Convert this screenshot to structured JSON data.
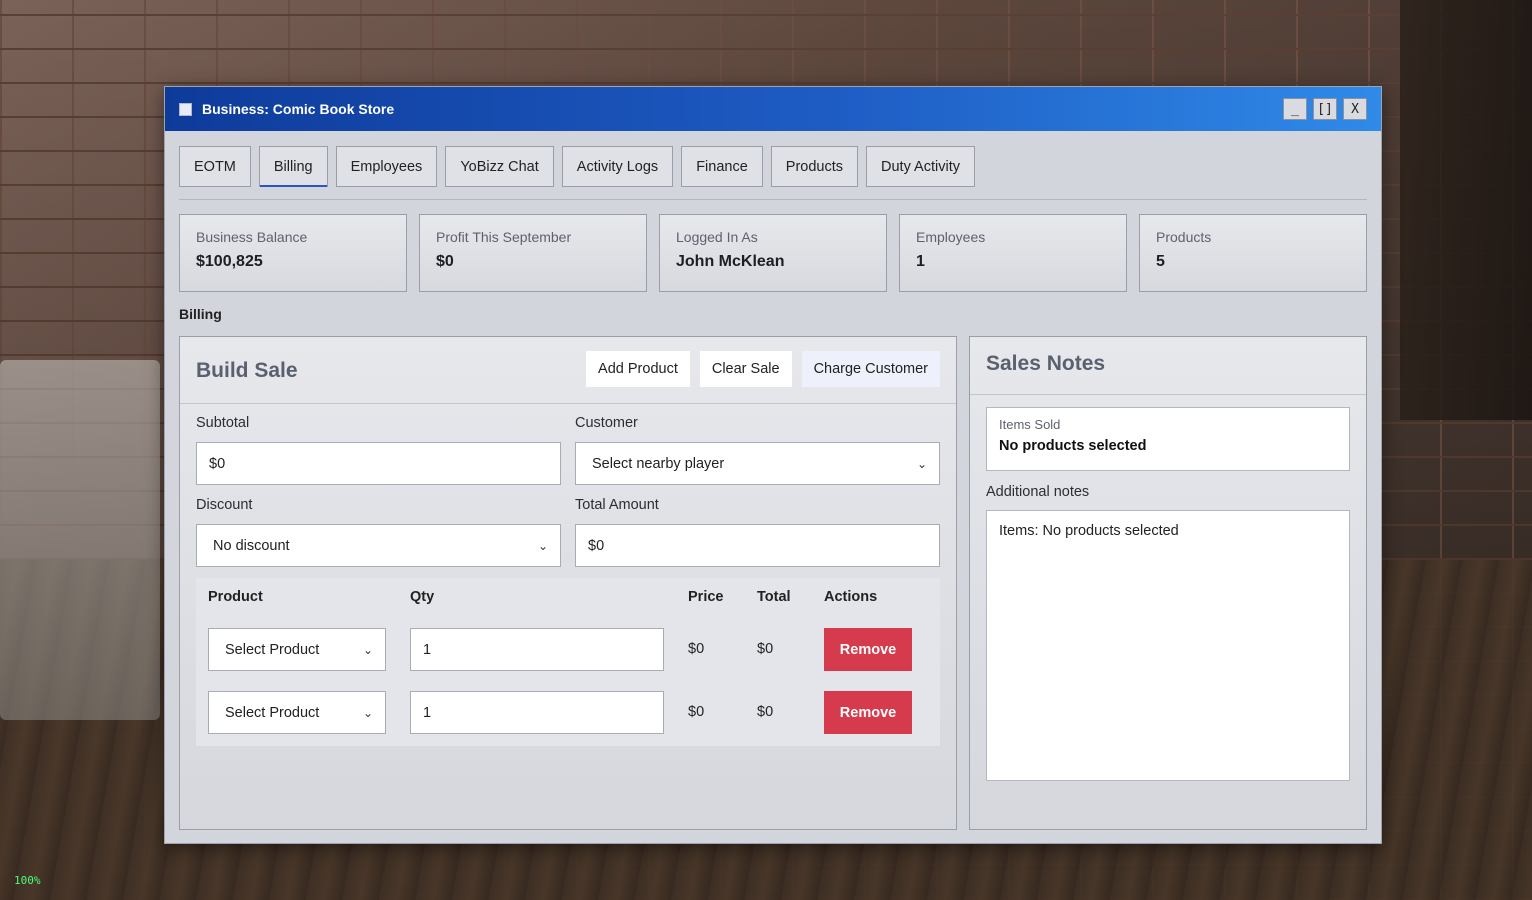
{
  "window": {
    "title": "Business: Comic Book Store",
    "controls": {
      "minimize": "_",
      "maximize": "[]",
      "close": "X"
    }
  },
  "tabs": [
    {
      "label": "EOTM"
    },
    {
      "label": "Billing",
      "active": true
    },
    {
      "label": "Employees"
    },
    {
      "label": "YoBizz Chat"
    },
    {
      "label": "Activity Logs"
    },
    {
      "label": "Finance"
    },
    {
      "label": "Products"
    },
    {
      "label": "Duty Activity"
    }
  ],
  "stats": [
    {
      "label": "Business Balance",
      "value": "$100,825"
    },
    {
      "label": "Profit This September",
      "value": "$0"
    },
    {
      "label": "Logged In As",
      "value": "John McKlean"
    },
    {
      "label": "Employees",
      "value": "1"
    },
    {
      "label": "Products",
      "value": "5"
    }
  ],
  "section_label": "Billing",
  "build_sale": {
    "title": "Build Sale",
    "buttons": {
      "add_product": "Add Product",
      "clear_sale": "Clear Sale",
      "charge_customer": "Charge Customer"
    },
    "subtotal_label": "Subtotal",
    "subtotal_value": "$0",
    "customer_label": "Customer",
    "customer_value": "Select nearby player",
    "discount_label": "Discount",
    "discount_value": "No discount",
    "total_label": "Total Amount",
    "total_value": "$0",
    "table": {
      "headers": {
        "product": "Product",
        "qty": "Qty",
        "price": "Price",
        "total": "Total",
        "actions": "Actions"
      },
      "rows": [
        {
          "product": "Select Product",
          "qty": "1",
          "price": "$0",
          "total": "$0",
          "action": "Remove"
        },
        {
          "product": "Select Product",
          "qty": "1",
          "price": "$0",
          "total": "$0",
          "action": "Remove"
        }
      ]
    }
  },
  "sales_notes": {
    "title": "Sales Notes",
    "items_sold_label": "Items Sold",
    "items_sold_value": "No products selected",
    "additional_label": "Additional notes",
    "additional_value": "Items: No products selected"
  },
  "overlay": {
    "fps": "100%"
  },
  "colors": {
    "titlebar_start": "#0e3b9a",
    "titlebar_end": "#2f8ae8",
    "remove": "#d53a4d",
    "tab_active_underline": "#2e54c4"
  }
}
